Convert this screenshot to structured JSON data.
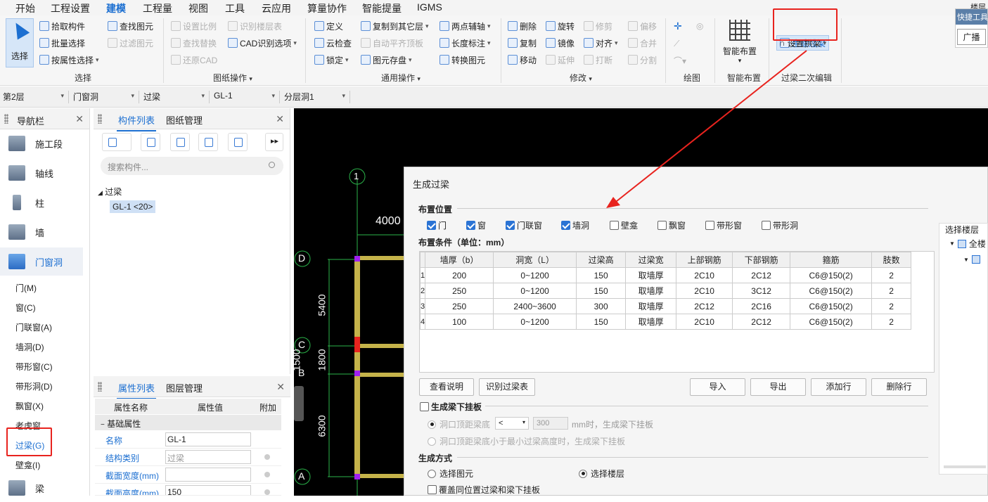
{
  "menu": [
    "开始",
    "工程设置",
    "建模",
    "工程量",
    "视图",
    "工具",
    "云应用",
    "算量协作",
    "智能提量",
    "IGMS"
  ],
  "ribbon": {
    "select": "选择",
    "pick": "拾取构件",
    "batch": "批量选择",
    "by_attr": "按属性选择",
    "find": "查找图元",
    "filter": "过滤图元",
    "group_select": "选择",
    "set_scale": "设置比例",
    "find_replace": "查找替换",
    "restore_cad": "还原CAD",
    "id_floor": "识别楼层表",
    "cad_opts": "CAD识别选项",
    "group_drawing": "图纸操作",
    "define": "定义",
    "cloud_check": "云检查",
    "lock": "锁定",
    "copy_floor": "复制到其它层",
    "auto_flush": "自动平齐顶板",
    "elem_save": "图元存盘",
    "two_point": "两点辅轴",
    "length_dim": "长度标注",
    "convert": "转换图元",
    "group_common": "通用操作",
    "delete": "删除",
    "copy": "复制",
    "move": "移动",
    "rotate": "旋转",
    "mirror": "镜像",
    "extend": "延伸",
    "trim": "修剪",
    "align": "对齐",
    "break": "打断",
    "offset": "偏移",
    "merge": "合并",
    "split": "分割",
    "group_modify": "修改",
    "group_draw": "绘图",
    "smart_layout": "智能布置",
    "group_smart": "智能布置",
    "gen_beam": "生成过梁",
    "set_arch": "设置拱梁",
    "group_beam": "过梁二次编辑"
  },
  "quick": {
    "title": "快捷工具",
    "btn": "广播",
    "top": "楼层二"
  },
  "selectors": [
    "第2层",
    "门窗洞",
    "过梁",
    "GL-1",
    "分层洞1"
  ],
  "nav": {
    "title": "导航栏",
    "big": [
      "施工段",
      "轴线",
      "柱",
      "墙",
      "门窗洞"
    ],
    "sub": [
      "门(M)",
      "窗(C)",
      "门联窗(A)",
      "墙洞(D)",
      "带形窗(C)",
      "带形洞(D)",
      "飘窗(X)",
      "老虎窗",
      "过梁(G)",
      "壁龛(I)"
    ],
    "beam": "梁"
  },
  "complist": {
    "tab1": "构件列表",
    "tab2": "图纸管理",
    "search": "搜索构件...",
    "tree_root": "过梁",
    "tree_item": "GL-1 <20>"
  },
  "props": {
    "tab1": "属性列表",
    "tab2": "图层管理",
    "h_name": "属性名称",
    "h_val": "属性值",
    "h_add": "附加",
    "section": "基础属性",
    "rows": [
      {
        "n": "名称",
        "v": "GL-1"
      },
      {
        "n": "结构类别",
        "v": "过梁"
      },
      {
        "n": "截面宽度(mm)",
        "v": ""
      },
      {
        "n": "截面高度(mm)",
        "v": "150"
      }
    ]
  },
  "canvas": {
    "axis1": "1",
    "dimW": "4000",
    "axD": "D",
    "axC": "C",
    "axB": "B",
    "axA": "A",
    "d1": "5400",
    "d2": "1800",
    "d3": "6300",
    "d4": "1500"
  },
  "dialog": {
    "title": "生成过梁",
    "sec_pos": "布置位置",
    "checks": [
      {
        "l": "门",
        "on": true
      },
      {
        "l": "窗",
        "on": true
      },
      {
        "l": "门联窗",
        "on": true
      },
      {
        "l": "墙洞",
        "on": true
      },
      {
        "l": "壁龛",
        "on": false
      },
      {
        "l": "飘窗",
        "on": false
      },
      {
        "l": "带形窗",
        "on": false
      },
      {
        "l": "带形洞",
        "on": false
      }
    ],
    "sec_cond": "布置条件（单位：mm）",
    "headers": [
      "墙厚（b）",
      "洞宽（L）",
      "过梁高",
      "过梁宽",
      "上部钢筋",
      "下部钢筋",
      "箍筋",
      "肢数"
    ],
    "rows": [
      [
        "1",
        "200",
        "0~1200",
        "150",
        "取墙厚",
        "2C10",
        "2C12",
        "C6@150(2)",
        "2"
      ],
      [
        "2",
        "250",
        "0~1200",
        "150",
        "取墙厚",
        "2C10",
        "3C12",
        "C6@150(2)",
        "2"
      ],
      [
        "3",
        "250",
        "2400~3600",
        "300",
        "取墙厚",
        "2C12",
        "2C16",
        "C6@150(2)",
        "2"
      ],
      [
        "4",
        "100",
        "0~1200",
        "150",
        "取墙厚",
        "2C10",
        "2C12",
        "C6@150(2)",
        "2"
      ]
    ],
    "btn_explain": "查看说明",
    "btn_idtable": "识别过梁表",
    "btn_import": "导入",
    "btn_export": "导出",
    "btn_add": "添加行",
    "btn_del": "删除行",
    "gen_hang": "生成梁下挂板",
    "r1": "洞口顶距梁底",
    "r1_op": "<",
    "r1_val": "300",
    "r1_tail": "mm时，生成梁下挂板",
    "r2": "洞口顶距梁底小于最小过梁高度时，生成梁下挂板",
    "sec_mode": "生成方式",
    "mode1": "选择图元",
    "mode2": "选择楼层",
    "overwrite": "覆盖同位置过梁和梁下挂板",
    "floor_title": "选择楼层",
    "floor_all": "全楼"
  },
  "colors": {
    "accent": "#1c6fd1",
    "highlight": "#e8231e"
  }
}
